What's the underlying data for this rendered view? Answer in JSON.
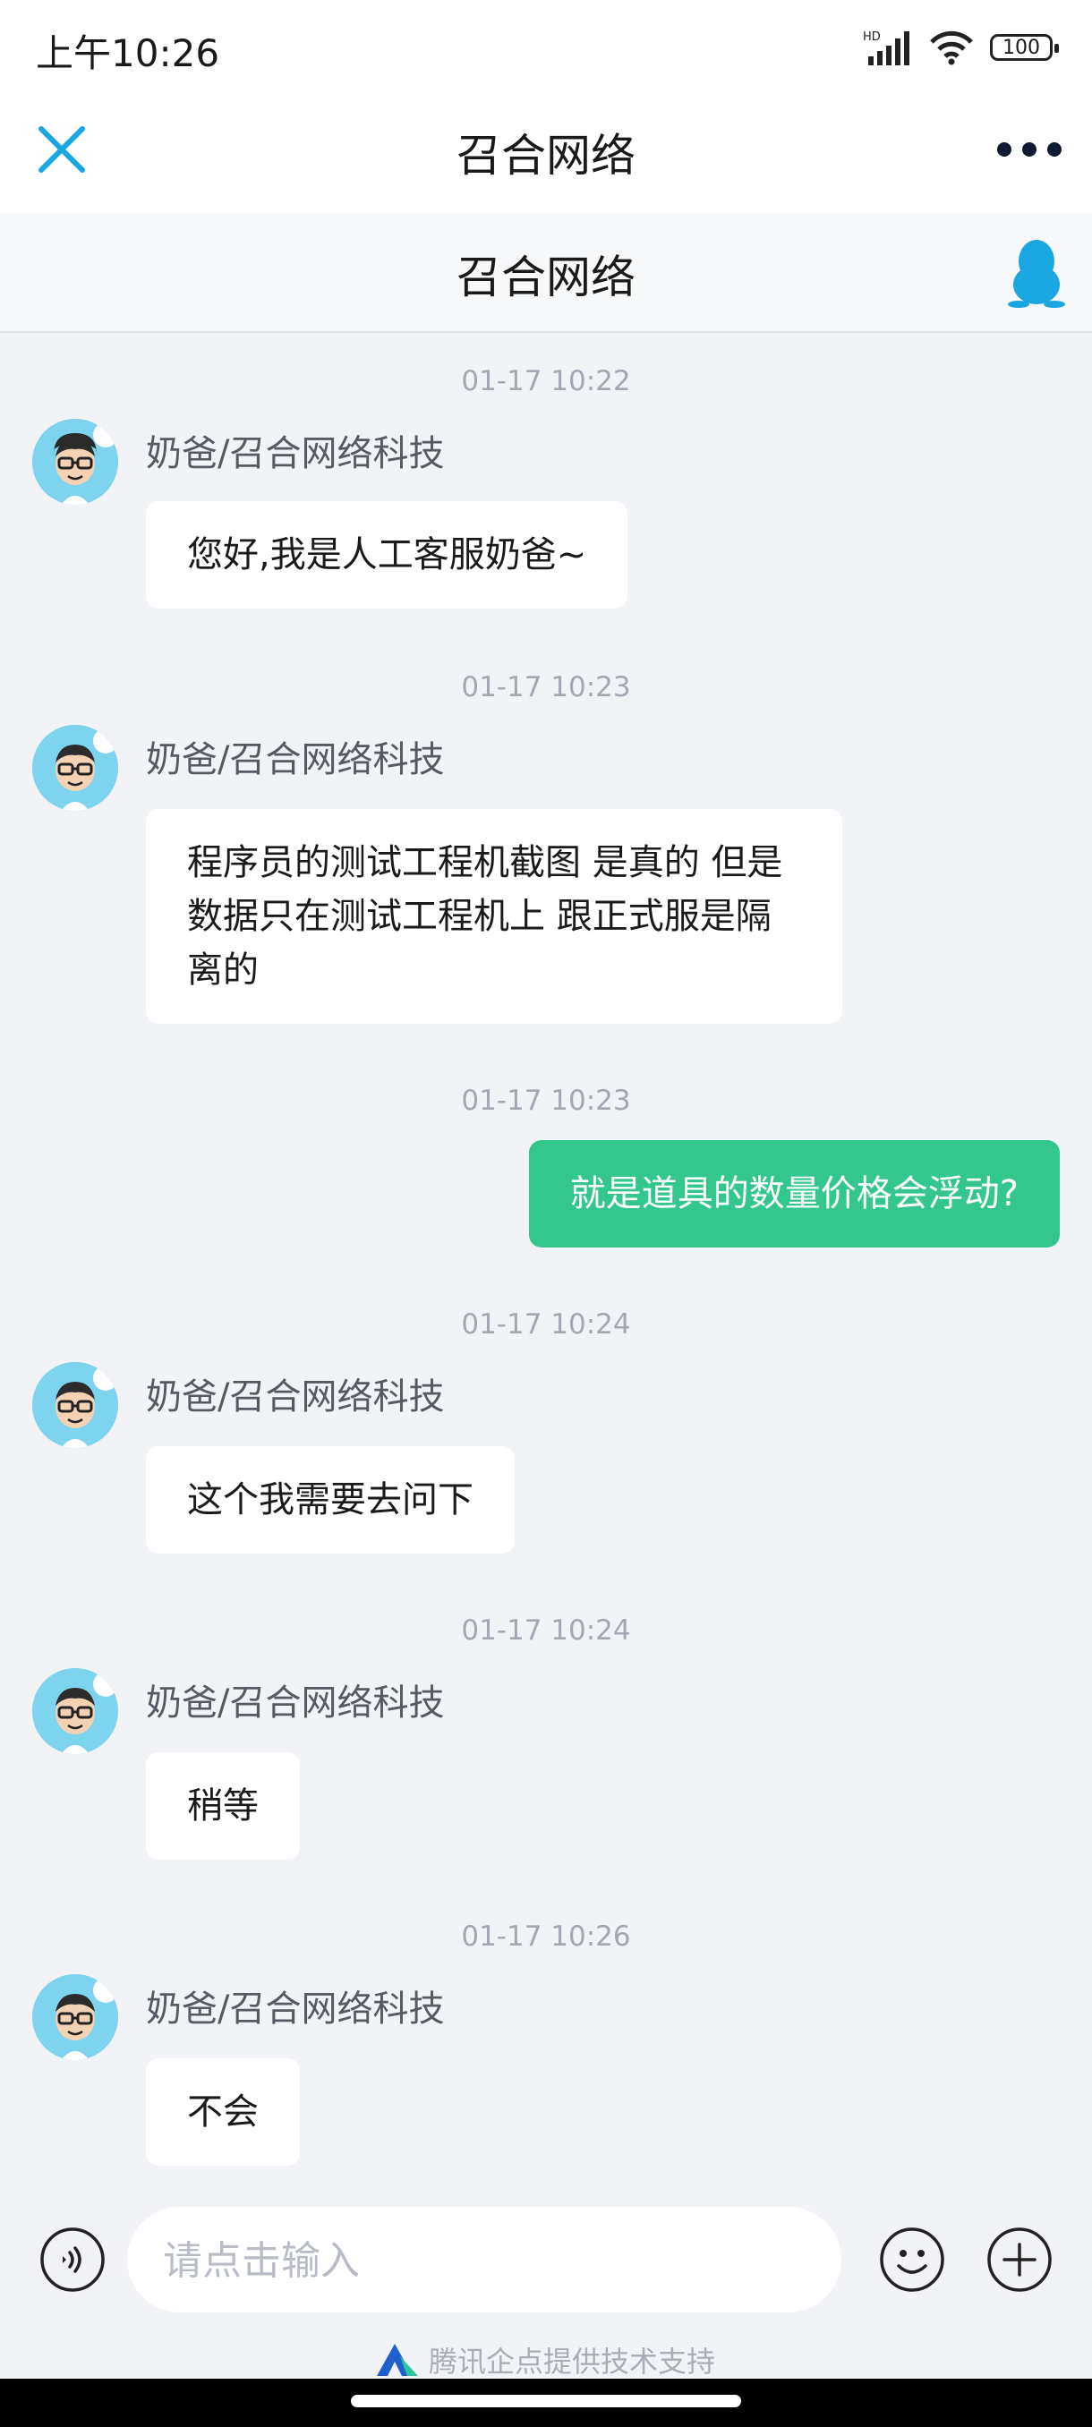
{
  "status_bar": {
    "time": "上午10:26",
    "network": "HD",
    "battery": "100"
  },
  "nav": {
    "title": "召合网络"
  },
  "subheader": {
    "title": "召合网络"
  },
  "messages": [
    {
      "timestamp": "01-17 10:22",
      "sender": "奶爸/召合网络科技",
      "text": "您好,我是人工客服奶爸~"
    },
    {
      "timestamp": "01-17 10:23",
      "sender": "奶爸/召合网络科技",
      "text": "程序员的测试工程机截图 是真的  但是 数据只在测试工程机上 跟正式服是隔离的"
    },
    {
      "timestamp": "01-17 10:23",
      "text": "就是道具的数量价格会浮动?"
    },
    {
      "timestamp": "01-17 10:24",
      "sender": "奶爸/召合网络科技",
      "text": "这个我需要去问下"
    },
    {
      "timestamp": "01-17 10:24",
      "sender": "奶爸/召合网络科技",
      "text": "稍等"
    },
    {
      "timestamp": "01-17 10:26",
      "sender": "奶爸/召合网络科技",
      "text": "不会"
    }
  ],
  "input": {
    "placeholder": "请点击输入",
    "value": ""
  },
  "footer": {
    "powered_by": "腾讯企点提供技术支持"
  },
  "colors": {
    "accent": "#33c78e",
    "close_icon": "#1aa6e0",
    "background": "#f2f3f7"
  }
}
